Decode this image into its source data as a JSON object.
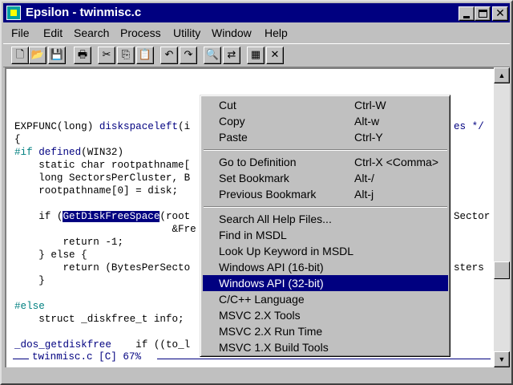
{
  "window": {
    "title": "Epsilon - twinmisc.c"
  },
  "menubar": [
    "File",
    "Edit",
    "Search",
    "Process",
    "Utility",
    "Window",
    "Help"
  ],
  "toolbar": {
    "buttons": [
      {
        "name": "new-file-icon",
        "glyph": "🗋"
      },
      {
        "name": "open-folder-icon",
        "glyph": "📂"
      },
      {
        "name": "save-disk-icon",
        "glyph": "💾"
      },
      {
        "name": "print-icon",
        "glyph": "🖶"
      },
      {
        "name": "cut-scissors-icon",
        "glyph": "✂"
      },
      {
        "name": "copy-icon",
        "glyph": "⎘"
      },
      {
        "name": "paste-clipboard-icon",
        "glyph": "📋"
      },
      {
        "name": "undo-icon",
        "glyph": "↶"
      },
      {
        "name": "redo-icon",
        "glyph": "↷"
      },
      {
        "name": "find-magnifier-icon",
        "glyph": "🔍"
      },
      {
        "name": "find-replace-icon",
        "glyph": "⇄"
      },
      {
        "name": "grid-icon",
        "glyph": "▦"
      },
      {
        "name": "close-x-icon",
        "glyph": "✕"
      }
    ]
  },
  "code": {
    "lines": [
      {
        "a": "EXPFUNC(long) ",
        "b": "diskspaceleft",
        "c": "(i",
        "tail": "es */"
      },
      {
        "a": "{"
      },
      {
        "pp": "#if ",
        "kw": "defined",
        "a2": "(WIN32)"
      },
      {
        "a": "    static char rootpathname["
      },
      {
        "a": "    long SectorsPerCluster, B"
      },
      {
        "a": "    rootpathname[0] = disk;"
      },
      {
        "a": ""
      },
      {
        "a": "    if (",
        "hl": "GetDiskFreeSpace",
        "c": "(root",
        "tail": "Sector"
      },
      {
        "a": "                          &Fre"
      },
      {
        "a": "        return -1;"
      },
      {
        "a": "    } else {"
      },
      {
        "a": "        return (BytesPerSecto",
        "tail": "sters"
      },
      {
        "a": "    }"
      },
      {
        "a": ""
      },
      {
        "pp": "#else"
      },
      {
        "a": "    struct _diskfree_t info;"
      },
      {
        "a": ""
      },
      {
        "a": "    if (",
        "kw": "_dos_getdiskfree",
        "c": "(to_l"
      }
    ],
    "status": "twinmisc.c [C] 67%"
  },
  "context_menu": {
    "groups": [
      [
        {
          "label": "Cut",
          "accel": "Ctrl-W"
        },
        {
          "label": "Copy",
          "accel": "Alt-w"
        },
        {
          "label": "Paste",
          "accel": "Ctrl-Y"
        }
      ],
      [
        {
          "label": "Go to Definition",
          "accel": "Ctrl-X <Comma>"
        },
        {
          "label": "Set Bookmark",
          "accel": "Alt-/"
        },
        {
          "label": "Previous Bookmark",
          "accel": "Alt-j"
        }
      ],
      [
        {
          "label": "Search All Help Files...",
          "accel": ""
        },
        {
          "label": "Find in MSDL",
          "accel": ""
        },
        {
          "label": "Look Up Keyword in MSDL",
          "accel": ""
        },
        {
          "label": "Windows API (16-bit)",
          "accel": ""
        },
        {
          "label": "Windows API (32-bit)",
          "accel": "",
          "selected": true
        },
        {
          "label": "C/C++ Language",
          "accel": ""
        },
        {
          "label": "MSVC 2.X Tools",
          "accel": ""
        },
        {
          "label": "MSVC 2.X Run Time",
          "accel": ""
        },
        {
          "label": "MSVC 1.X Build Tools",
          "accel": ""
        }
      ]
    ]
  },
  "colors": {
    "titlebar": "#000080",
    "selection": "#000080",
    "keyword": "#000080",
    "preprocessor": "#008080"
  }
}
